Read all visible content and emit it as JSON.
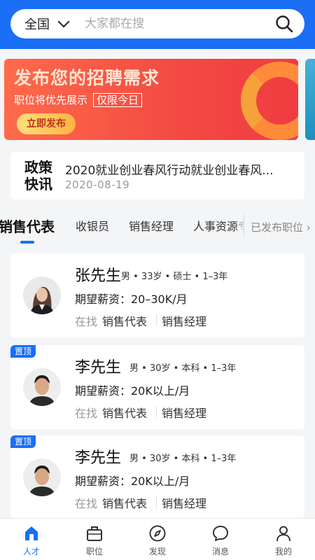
{
  "search": {
    "region": "全国",
    "placeholder": "大家都在搜"
  },
  "banner": {
    "title": "发布您的招聘需求",
    "subtitle": "职位将优先展示",
    "tag": "仅限今日",
    "button": "立即发布"
  },
  "news": {
    "label": "政策快讯",
    "title": "2020就业创业春风行动就业创业春风...",
    "date": "2020-08-19"
  },
  "tabs": {
    "items": [
      "销售代表",
      "收银员",
      "销售经理",
      "人事资源专"
    ],
    "active": "销售代表",
    "posted_jobs": "已发布职位 ›"
  },
  "cards": [
    {
      "name": "张先生",
      "meta": "男 • 33岁 • 硕士 • 1–3年",
      "salary": "期望薪资：20–30K/月",
      "seeking": "在找",
      "job1": "销售代表",
      "job2": "销售经理",
      "pinned": false
    },
    {
      "name": "李先生",
      "meta": "男 • 30岁 • 本科 • 1–3年",
      "salary": "期望薪资：20K以上/月",
      "seeking": "在找",
      "job1": "销售代表",
      "job2": "销售经理",
      "pinned": true,
      "pin_label": "置顶"
    },
    {
      "name": "李先生",
      "meta": "男 • 30岁 • 本科 • 1–3年",
      "salary": "期望薪资：20K以上/月",
      "seeking": "在找",
      "job1": "销售代表",
      "job2": "销售经理",
      "pinned": true,
      "pin_label": "置顶"
    }
  ],
  "nav": [
    {
      "label": "人才",
      "icon": "home-icon",
      "active": true
    },
    {
      "label": "职位",
      "icon": "briefcase-icon",
      "active": false
    },
    {
      "label": "发现",
      "icon": "compass-icon",
      "active": false
    },
    {
      "label": "消息",
      "icon": "chat-icon",
      "active": false
    },
    {
      "label": "我的",
      "icon": "user-icon",
      "active": false
    }
  ],
  "colors": {
    "primary": "#1a6ff5",
    "banner_red": "#f24a43",
    "banner_button": "#ffc04d"
  }
}
